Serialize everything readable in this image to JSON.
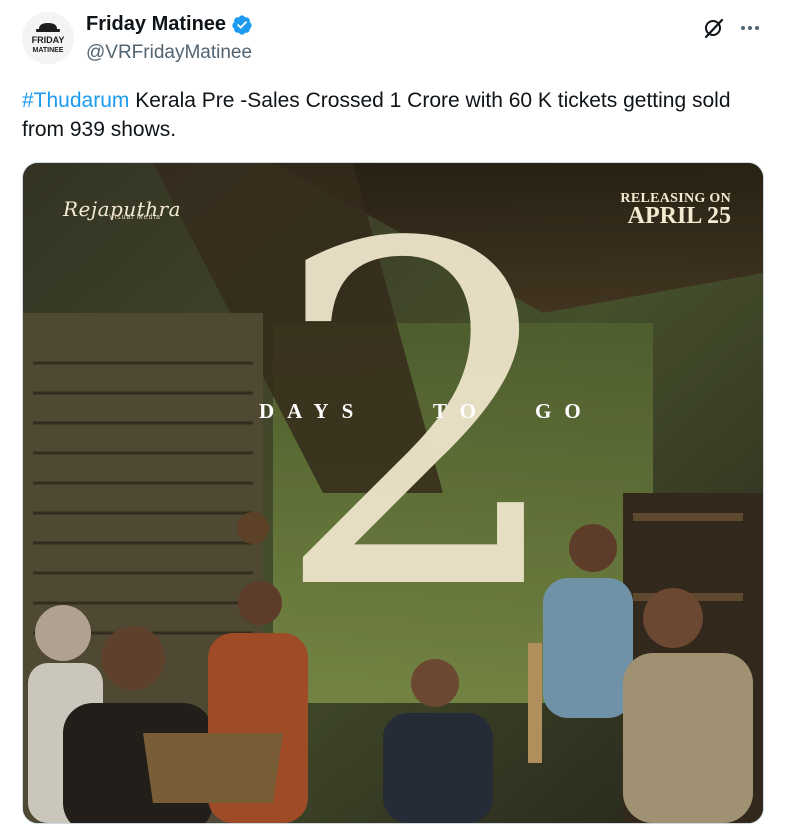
{
  "author": {
    "name": "Friday Matinee",
    "handle": "@VRFridayMatinee",
    "avatar_text_top": "FRIDAY",
    "avatar_text_bottom": "MATINEE",
    "verified_icon": "verified-badge-icon"
  },
  "actions": {
    "grok_icon": "grok-icon",
    "more_icon": "more-horizontal-icon"
  },
  "tweet": {
    "hashtag": "#Thudarum",
    "text": " Kerala Pre -Sales Crossed 1 Crore with 60 K tickets getting sold from 939 shows."
  },
  "poster": {
    "brand": "Rejaputhra",
    "brand_sub": "Visual Media",
    "release_label": "RELEASING ON",
    "release_date": "APRIL 25",
    "number": "2",
    "days_word": "DAYS",
    "to_word": "TO",
    "go_word": "GO"
  },
  "colors": {
    "hashtag": "#1d9bf0",
    "verified": "#1d9bf0",
    "handle": "#536471",
    "poster_number": "#ece3c9"
  }
}
